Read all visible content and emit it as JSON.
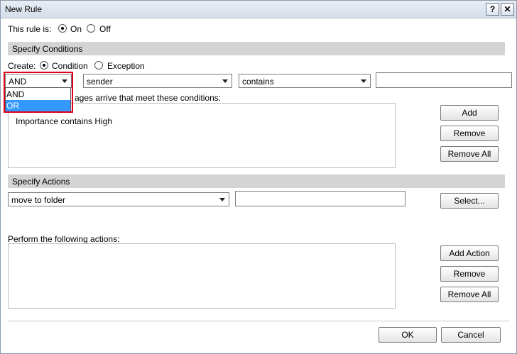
{
  "window": {
    "title": "New Rule",
    "help_glyph": "?",
    "close_glyph": "✕"
  },
  "status": {
    "label": "This rule is:",
    "on_label": "On",
    "off_label": "Off",
    "selected": "On"
  },
  "conditions": {
    "header": "Specify Conditions",
    "create_label": "Create:",
    "condition_label": "Condition",
    "exception_label": "Exception",
    "selected_type": "Condition",
    "logic_select": "AND",
    "logic_options": [
      "AND",
      "OR"
    ],
    "logic_highlighted": "OR",
    "field_select": "sender",
    "operator_select": "contains",
    "value_input": "",
    "list_label": "ages arrive that meet these conditions:",
    "items": [
      "Importance contains High"
    ],
    "add_label": "Add",
    "remove_label": "Remove",
    "remove_all_label": "Remove All"
  },
  "actions": {
    "header": "Specify Actions",
    "action_select": "move to folder",
    "target_input": "",
    "select_label": "Select...",
    "list_label": "Perform the following actions:",
    "items": [],
    "add_label": "Add Action",
    "remove_label": "Remove",
    "remove_all_label": "Remove All"
  },
  "footer": {
    "ok_label": "OK",
    "cancel_label": "Cancel"
  }
}
